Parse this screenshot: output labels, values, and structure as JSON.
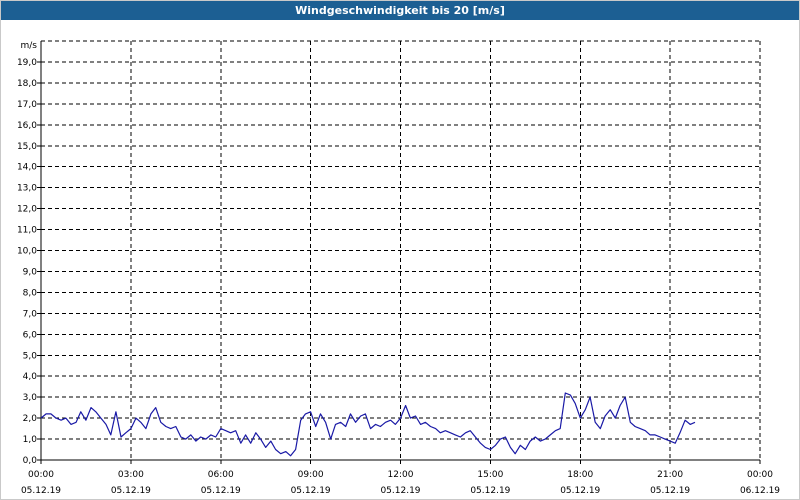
{
  "window": {
    "title": "Windgeschwindigkeit bis 20 [m/s]"
  },
  "colors": {
    "title_bar": "#1c5f93",
    "series": "#1a1aa6",
    "grid": "#000000"
  },
  "chart_data": {
    "type": "line",
    "title": "Windgeschwindigkeit bis 20 [m/s]",
    "ylabel": "m/s",
    "xlabel": "",
    "ylim": [
      0,
      20
    ],
    "xlim": [
      "05.12.19 00:00",
      "06.12.19 00:00"
    ],
    "grid": true,
    "y_ticks": [
      "0,0",
      "1,0",
      "2,0",
      "3,0",
      "4,0",
      "5,0",
      "6,0",
      "7,0",
      "8,0",
      "9,0",
      "10,0",
      "11,0",
      "12,0",
      "13,0",
      "14,0",
      "15,0",
      "16,0",
      "17,0",
      "18,0",
      "19,0"
    ],
    "x_ticks": [
      {
        "time": "00:00",
        "date": "05.12.19"
      },
      {
        "time": "03:00",
        "date": "05.12.19"
      },
      {
        "time": "06:00",
        "date": "05.12.19"
      },
      {
        "time": "09:00",
        "date": "05.12.19"
      },
      {
        "time": "12:00",
        "date": "05.12.19"
      },
      {
        "time": "15:00",
        "date": "05.12.19"
      },
      {
        "time": "18:00",
        "date": "05.12.19"
      },
      {
        "time": "21:00",
        "date": "05.12.19"
      },
      {
        "time": "00:00",
        "date": "06.12.19"
      }
    ],
    "series": [
      {
        "x_hours": [
          0,
          0.17,
          0.33,
          0.5,
          0.67,
          0.83,
          1,
          1.17,
          1.33,
          1.5,
          1.67,
          1.83,
          2,
          2.17,
          2.33,
          2.5,
          2.67,
          2.83,
          3,
          3.17,
          3.33,
          3.5,
          3.67,
          3.83,
          4,
          4.17,
          4.33,
          4.5,
          4.67,
          4.83,
          5,
          5.17,
          5.33,
          5.5,
          5.67,
          5.83,
          6,
          6.17,
          6.33,
          6.5,
          6.67,
          6.83,
          7,
          7.17,
          7.33,
          7.5,
          7.67,
          7.83,
          8,
          8.17,
          8.33,
          8.5,
          8.67,
          8.83,
          9,
          9.17,
          9.33,
          9.5,
          9.67,
          9.83,
          10,
          10.17,
          10.33,
          10.5,
          10.67,
          10.83,
          11,
          11.17,
          11.33,
          11.5,
          11.67,
          11.83,
          12,
          12.17,
          12.33,
          12.5,
          12.67,
          12.83,
          13,
          13.17,
          13.33,
          13.5,
          13.67,
          13.83,
          14,
          14.17,
          14.33,
          14.5,
          14.67,
          14.83,
          15,
          15.17,
          15.33,
          15.5,
          15.67,
          15.83,
          16,
          16.17,
          16.33,
          16.5,
          16.67,
          16.83,
          17,
          17.17,
          17.33,
          17.5,
          17.67,
          17.83,
          18,
          18.17,
          18.33,
          18.5,
          18.67,
          18.83,
          19,
          19.17,
          19.33,
          19.5,
          19.67,
          19.83,
          20,
          20.17,
          20.33,
          20.5,
          20.67,
          20.83,
          21,
          21.17,
          21.33,
          21.5,
          21.67,
          21.83,
          22,
          22.17,
          22.33,
          22.5,
          22.67,
          22.83,
          23,
          23.17,
          23.33,
          23.5,
          23.67,
          23.83,
          24
        ],
        "y": [
          2.0,
          2.2,
          2.2,
          2.0,
          1.9,
          2.0,
          1.7,
          1.8,
          2.3,
          1.9,
          2.5,
          2.3,
          2.0,
          1.7,
          1.2,
          2.3,
          1.1,
          1.3,
          1.5,
          2.0,
          1.8,
          1.5,
          2.2,
          2.5,
          1.8,
          1.6,
          1.5,
          1.6,
          1.1,
          1.0,
          1.2,
          0.9,
          1.1,
          1.0,
          1.2,
          1.1,
          1.5,
          1.4,
          1.3,
          1.4,
          0.8,
          1.2,
          0.8,
          1.3,
          1.0,
          0.6,
          0.9,
          0.5,
          0.3,
          0.4,
          0.2,
          0.5,
          1.9,
          2.2,
          2.3,
          1.6,
          2.2,
          1.8,
          1.0,
          1.7,
          1.8,
          1.6,
          2.2,
          1.8,
          2.1,
          2.2,
          1.5,
          1.7,
          1.6,
          1.8,
          1.9,
          1.7,
          2.0,
          2.6,
          2.0,
          2.1,
          1.7,
          1.8,
          1.6,
          1.5,
          1.3,
          1.4,
          1.3,
          1.2,
          1.1,
          1.3,
          1.4,
          1.1,
          0.8,
          0.6,
          0.5,
          0.7,
          1.0,
          1.1,
          0.6,
          0.3,
          0.7,
          0.5,
          0.9,
          1.1,
          0.9,
          1.0,
          1.2,
          1.4,
          1.5,
          3.2,
          3.1,
          2.7,
          2.0,
          2.4,
          3.0,
          1.8,
          1.5,
          2.1,
          2.4,
          2.0,
          2.6,
          3.0,
          1.8,
          1.6,
          1.5,
          1.4,
          1.2,
          1.2,
          1.1,
          1.0,
          0.9,
          0.8,
          1.3,
          1.9,
          1.7,
          1.8
        ]
      }
    ]
  }
}
